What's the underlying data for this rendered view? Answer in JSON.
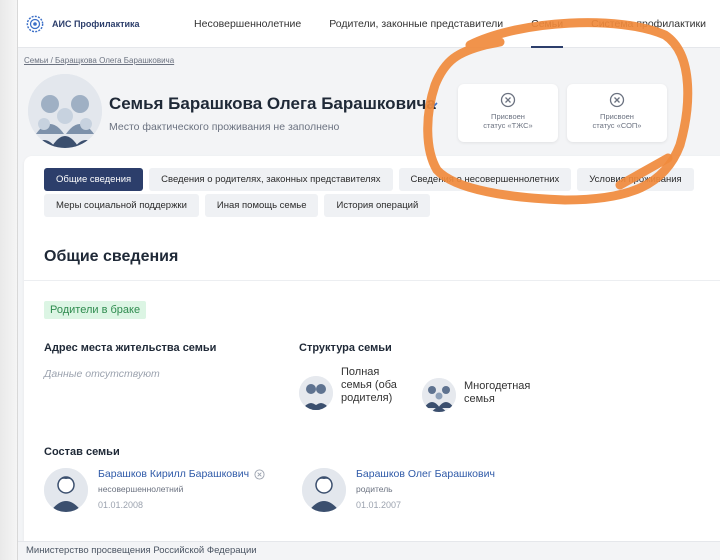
{
  "app": {
    "logo_text": "АИС Профилактика",
    "logo_icon": "gear-emblem-icon"
  },
  "nav": {
    "items": [
      {
        "label": "Несовершеннолетние"
      },
      {
        "label": "Родители, законные представители"
      },
      {
        "label": "Семьи",
        "active": true
      },
      {
        "label": "Система профилактики"
      }
    ]
  },
  "breadcrumb": {
    "root": "Семьи",
    "separator": " / ",
    "current": "Баращкова Олега Барашковича"
  },
  "header": {
    "title": "Семья Барашкова Олега Барашковича",
    "subtitle": "Место фактического проживания не заполнено",
    "status_cards": [
      {
        "line1": "Присвоен",
        "line2": "статус «ТЖС»",
        "icon": "x-circle-icon"
      },
      {
        "line1": "Присвоен",
        "line2": "статус «СОП»",
        "icon": "x-circle-icon"
      }
    ]
  },
  "tabs": {
    "row1": [
      {
        "label": "Общие сведения",
        "active": true
      },
      {
        "label": "Сведения о родителях, законных представителях"
      },
      {
        "label": "Сведения о несовершеннолетних"
      },
      {
        "label": "Условия проживания"
      }
    ],
    "row2": [
      {
        "label": "Меры социальной поддержки"
      },
      {
        "label": "Иная помощь семье"
      },
      {
        "label": "История операций"
      }
    ]
  },
  "section": {
    "title": "Общие сведения",
    "badge": "Родители в браке",
    "address_label": "Адрес места жительства семьи",
    "address_value": "Данные отсутствуют",
    "structure_label": "Структура семьи",
    "structure_items": [
      {
        "text": "Полная семья (оба родителя)"
      },
      {
        "text": "Многодетная семья"
      }
    ],
    "members_label": "Состав семьи",
    "members": [
      {
        "name": "Барашков Кирилл Барашкович",
        "role": "несовершеннолетний",
        "date": "01.01.2008",
        "removable": true
      },
      {
        "name": "Барашков Олег Барашкович",
        "role": "родитель",
        "date": "01.01.2007",
        "removable": false
      }
    ]
  },
  "footer": {
    "text": "Министерство просвещения Российской Федерации"
  },
  "colors": {
    "brand": "#2c3e6b",
    "link": "#2f5aa8",
    "badge_bg": "#dcf5e4",
    "badge_text": "#2e8b4e",
    "annotation": "#f08a3c"
  }
}
